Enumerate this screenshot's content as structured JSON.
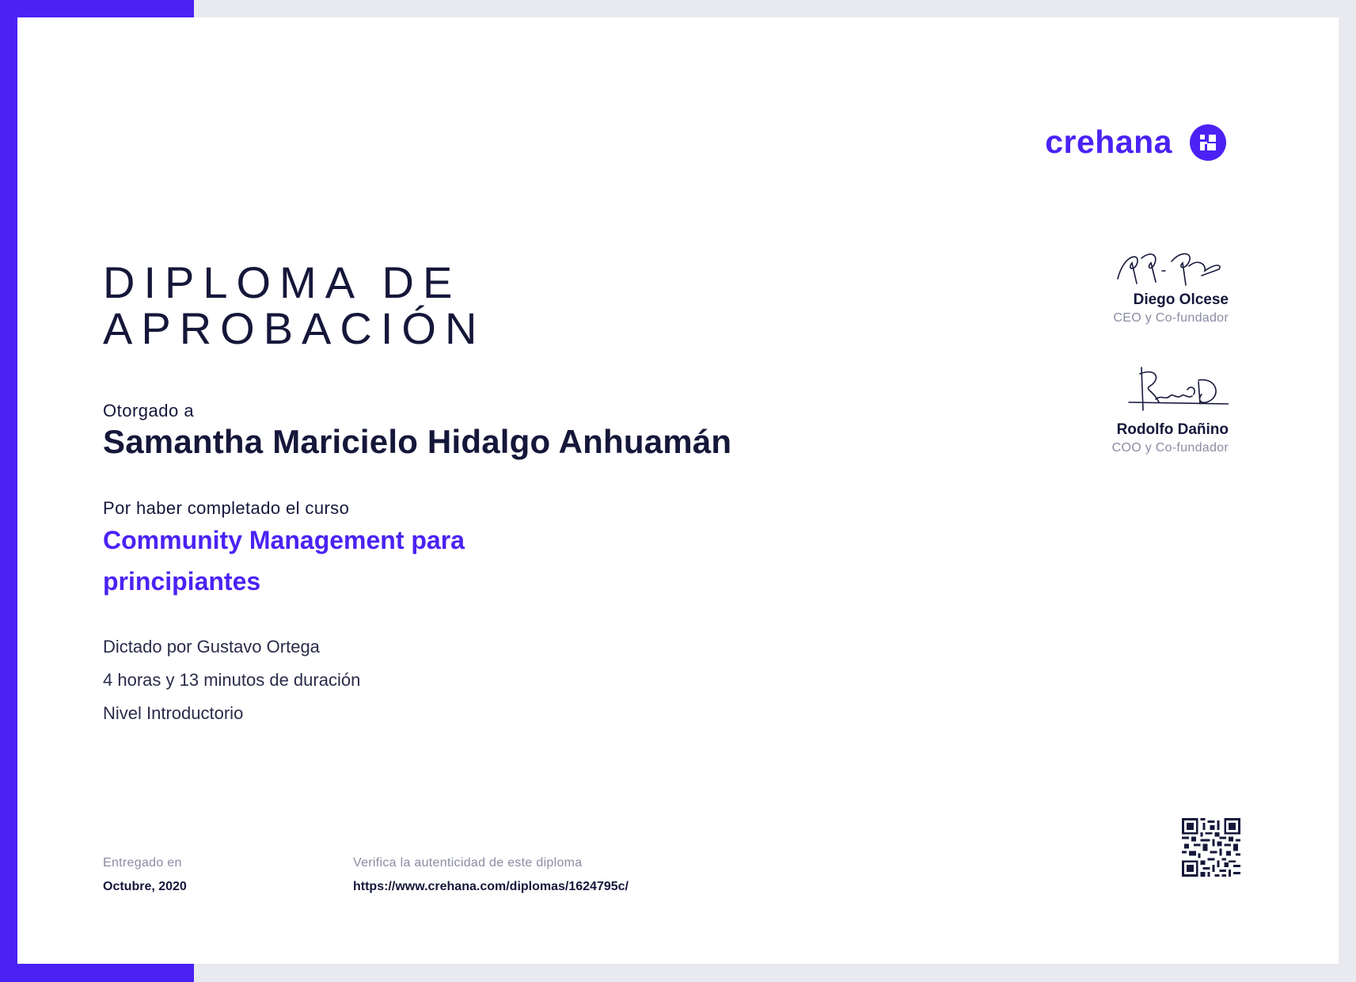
{
  "colors": {
    "accent": "#4b22f4",
    "text": "#15173a",
    "muted": "#8a8ca3",
    "frame": "#e9eaf0"
  },
  "brand": {
    "name": "crehana",
    "icon": "crehana-logo-icon"
  },
  "diploma": {
    "title_line1": "DIPLOMA DE",
    "title_line2": "APROBACIÓN",
    "awarded_label": "Otorgado a",
    "student_name": "Samantha Maricielo Hidalgo Anhuamán",
    "course_label": "Por haber completado el curso",
    "course_line1": "Community Management para",
    "course_line2": "principiantes",
    "instructor": "Dictado por Gustavo Ortega",
    "duration": "4 horas y 13 minutos de duración",
    "level": "Nivel Introductorio"
  },
  "signatories": [
    {
      "name": "Diego Olcese",
      "role": "CEO y Co-fundador"
    },
    {
      "name": "Rodolfo Dañino",
      "role": "COO y Co-fundador"
    }
  ],
  "footer": {
    "issued_label": "Entregado en",
    "issued_value": "Octubre, 2020",
    "verify_label": "Verifica la autenticidad de este diploma",
    "verify_url": "https://www.crehana.com/diplomas/1624795c/",
    "qr_icon": "qr-code-icon"
  }
}
